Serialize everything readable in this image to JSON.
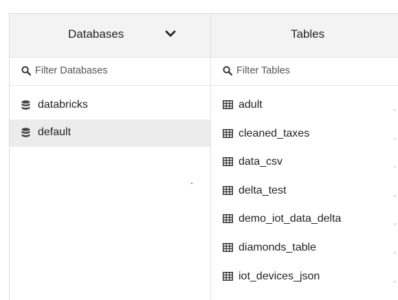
{
  "databases_panel": {
    "header_label": "Databases",
    "filter_placeholder": "Filter Databases",
    "items": [
      {
        "label": "databricks",
        "selected": false
      },
      {
        "label": "default",
        "selected": true
      }
    ]
  },
  "tables_panel": {
    "header_label": "Tables",
    "filter_placeholder": "Filter Tables",
    "items": [
      {
        "label": "adult"
      },
      {
        "label": "cleaned_taxes"
      },
      {
        "label": "data_csv"
      },
      {
        "label": "delta_test"
      },
      {
        "label": "demo_iot_data_delta"
      },
      {
        "label": "diamonds_table"
      },
      {
        "label": "iot_devices_json"
      }
    ]
  },
  "icons": {
    "header_dropdown": "chevron-down-icon",
    "filter": "search-icon",
    "database": "database-icon",
    "table": "table-icon",
    "row_menu": "chevron-down-icon"
  },
  "colors": {
    "header_bg": "#f3f3f3",
    "selected_row_bg": "#ececec",
    "border": "#dcdcdc",
    "text": "#222222"
  }
}
